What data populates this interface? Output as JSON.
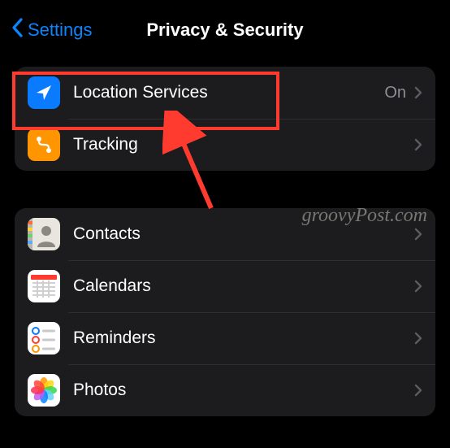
{
  "nav": {
    "back_label": "Settings",
    "title": "Privacy & Security"
  },
  "groups": [
    {
      "rows": [
        {
          "icon": "location-arrow",
          "label": "Location Services",
          "value": "On"
        },
        {
          "icon": "tracking",
          "label": "Tracking",
          "value": ""
        }
      ]
    },
    {
      "rows": [
        {
          "icon": "contacts",
          "label": "Contacts",
          "value": ""
        },
        {
          "icon": "calendars",
          "label": "Calendars",
          "value": ""
        },
        {
          "icon": "reminders",
          "label": "Reminders",
          "value": ""
        },
        {
          "icon": "photos",
          "label": "Photos",
          "value": ""
        }
      ]
    }
  ],
  "watermark": "groovyPost.com",
  "colors": {
    "accent": "#0a84ff",
    "highlight": "#ff3b30"
  }
}
